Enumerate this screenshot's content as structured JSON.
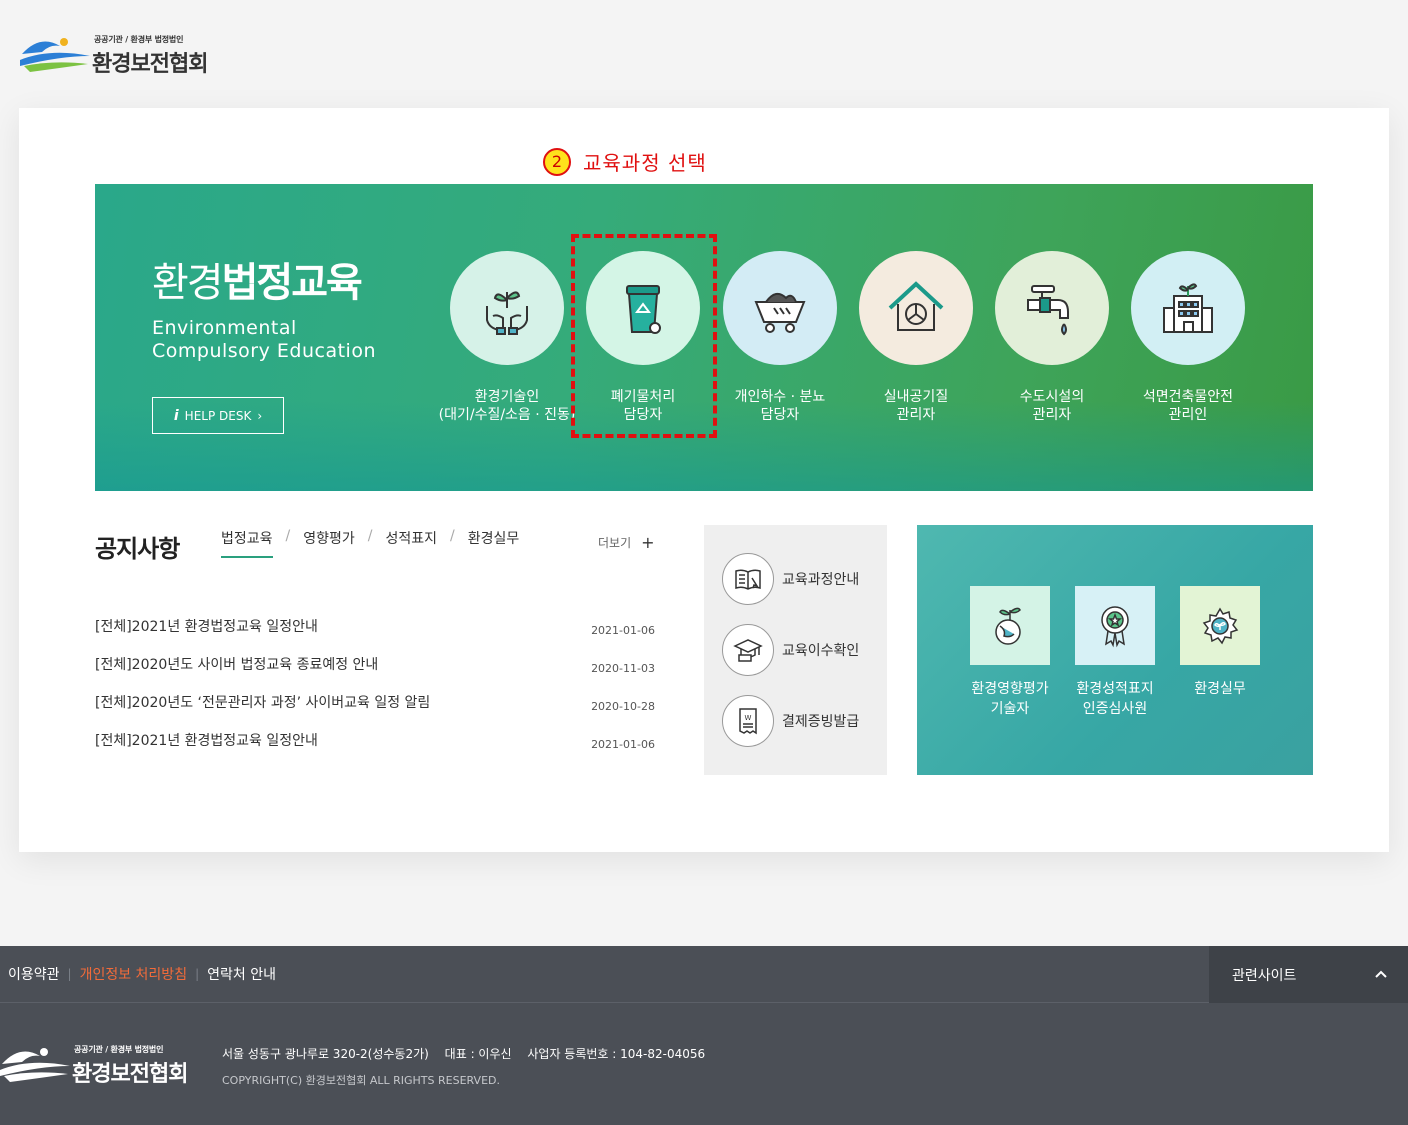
{
  "header": {
    "logo_sub": "공공기관 / 환경부 법정법인",
    "logo_main": "환경보전협회"
  },
  "annotation": {
    "number": "2",
    "text": "교육과정 선택",
    "color": "#e01010"
  },
  "banner": {
    "title_light": "환경",
    "title_bold": "법정교육",
    "subtitle_line1": "Environmental",
    "subtitle_line2": "Compulsory Education",
    "helpdesk_label": "HELP DESK",
    "categories": [
      {
        "icon": "hands-plant-icon",
        "line1": "환경기술인",
        "line2": "(대기/수질/소음 · 진동)"
      },
      {
        "icon": "recycle-bin-icon",
        "line1": "폐기물처리",
        "line2": "담당자"
      },
      {
        "icon": "cart-icon",
        "line1": "개인하수 · 분뇨",
        "line2": "담당자"
      },
      {
        "icon": "house-fan-icon",
        "line1": "실내공기질",
        "line2": "관리자"
      },
      {
        "icon": "water-tap-icon",
        "line1": "수도시설의",
        "line2": "관리자"
      },
      {
        "icon": "building-icon",
        "line1": "석면건축물안전",
        "line2": "관리인"
      }
    ]
  },
  "notice": {
    "title": "공지사항",
    "tabs": [
      "법정교육",
      "영향평가",
      "성적표지",
      "환경실무"
    ],
    "more_label": "더보기",
    "items": [
      {
        "title": "[전체]2021년 환경법정교육 일정안내",
        "date": "2021-01-06"
      },
      {
        "title": "[전체]2020년도 사이버 법정교육 종료예정 안내",
        "date": "2020-11-03"
      },
      {
        "title": "[전체]2020년도 ‘전문관리자 과정’ 사이버교육 일정 알림",
        "date": "2020-10-28"
      },
      {
        "title": "[전체]2021년 환경법정교육 일정안내",
        "date": "2021-01-06"
      }
    ]
  },
  "services": [
    {
      "icon": "book-icon",
      "label": "교육과정안내"
    },
    {
      "icon": "graduation-cap-icon",
      "label": "교육이수확인"
    },
    {
      "icon": "receipt-icon",
      "label": "결제증빙발급"
    }
  ],
  "programs": [
    {
      "icon": "globe-plant-icon",
      "line1": "환경영향평가",
      "line2": "기술자"
    },
    {
      "icon": "award-icon",
      "line1": "환경성적표지",
      "line2": "인증심사원"
    },
    {
      "icon": "gear-leaf-icon",
      "line1": "환경실무",
      "line2": ""
    }
  ],
  "footer": {
    "links": [
      "이용약관",
      "개인정보 처리방침",
      "연락처 안내"
    ],
    "related_label": "관련사이트",
    "address": "서울 성동구 광나루로 320-2(성수동2가)",
    "ceo": "대표 : 이우신",
    "biz_no": "사업자 등록번호 : 104-82-04056",
    "copyright": "COPYRIGHT(C) 환경보전협회 ALL RIGHTS RESERVED."
  }
}
